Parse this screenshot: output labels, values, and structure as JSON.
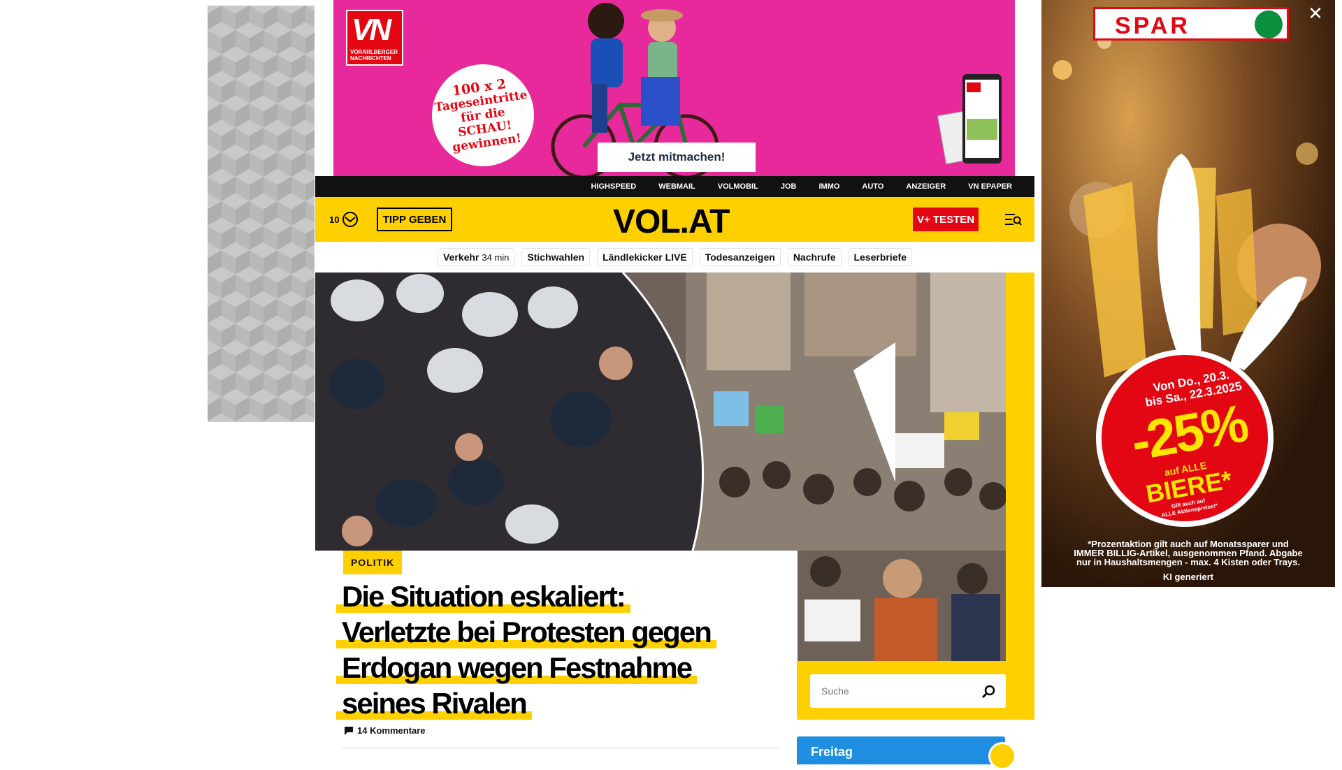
{
  "top_banner": {
    "logo_big": "VN",
    "logo_small_line1": "VORARLBERGER",
    "logo_small_line2": "NACHRICHTEN",
    "promo_line1": "100 x 2",
    "promo_line2": "Tageseintritte",
    "promo_line3": "für die SCHAU!",
    "promo_line4": "gewinnen!",
    "cta_label": "Jetzt mitmachen!",
    "background_color": "#e8299b"
  },
  "service_nav": {
    "items": [
      "HIGHSPEED",
      "WEBMAIL",
      "VOLMOBIL",
      "JOB",
      "IMMO",
      "AUTO",
      "ANZEIGER",
      "VN EPAPER"
    ]
  },
  "header": {
    "weather_temp": "10",
    "weather_icon": "cloud-sun-icon",
    "tipp_label": "TIPP GEBEN",
    "logo": "VOL.AT",
    "vplus_label": "V+ TESTEN",
    "menu_icon": "search-menu-icon",
    "accent_color": "#ffd000",
    "brand_red": "#e30613"
  },
  "quicklinks": [
    {
      "label": "Verkehr",
      "sub": "34 min"
    },
    {
      "label": "Stichwahlen",
      "sub": ""
    },
    {
      "label": "Ländlekicker LIVE",
      "sub": ""
    },
    {
      "label": "Todesanzeigen",
      "sub": ""
    },
    {
      "label": "Nachrufe",
      "sub": ""
    },
    {
      "label": "Leserbriefe",
      "sub": ""
    }
  ],
  "article": {
    "category": "POLITIK",
    "headline_lines": [
      "Die Situation eskaliert:",
      "Verletzte bei Protesten gegen",
      "Erdogan wegen Festnahme",
      "seines Rivalen"
    ],
    "comments": "14 Kommentare",
    "comment_icon": "comment-icon"
  },
  "search": {
    "placeholder": "Suche",
    "icon": "search-icon"
  },
  "weather_card": {
    "day": "Freitag"
  },
  "right_ad": {
    "brand": "SPAR",
    "close": "✕",
    "date_line1": "Von Do., 20.3.",
    "date_line2": "bis Sa., 22.3.2025",
    "percent": "-25%",
    "auf": "auf ALLE",
    "product": "BIERE*",
    "gilt_line1": "Gilt auch auf",
    "gilt_line2": "ALLE Aktionspreise!*",
    "disclaimer_line1": "*Prozentaktion gilt auch auf Monatssparer und",
    "disclaimer_line2": "IMMER BILLIG-Artikel, ausgenommen Pfand. Abgabe",
    "disclaimer_line3": "nur in Haushaltsmengen - max. 4 Kisten oder Trays.",
    "ki_note": "KI generiert"
  }
}
